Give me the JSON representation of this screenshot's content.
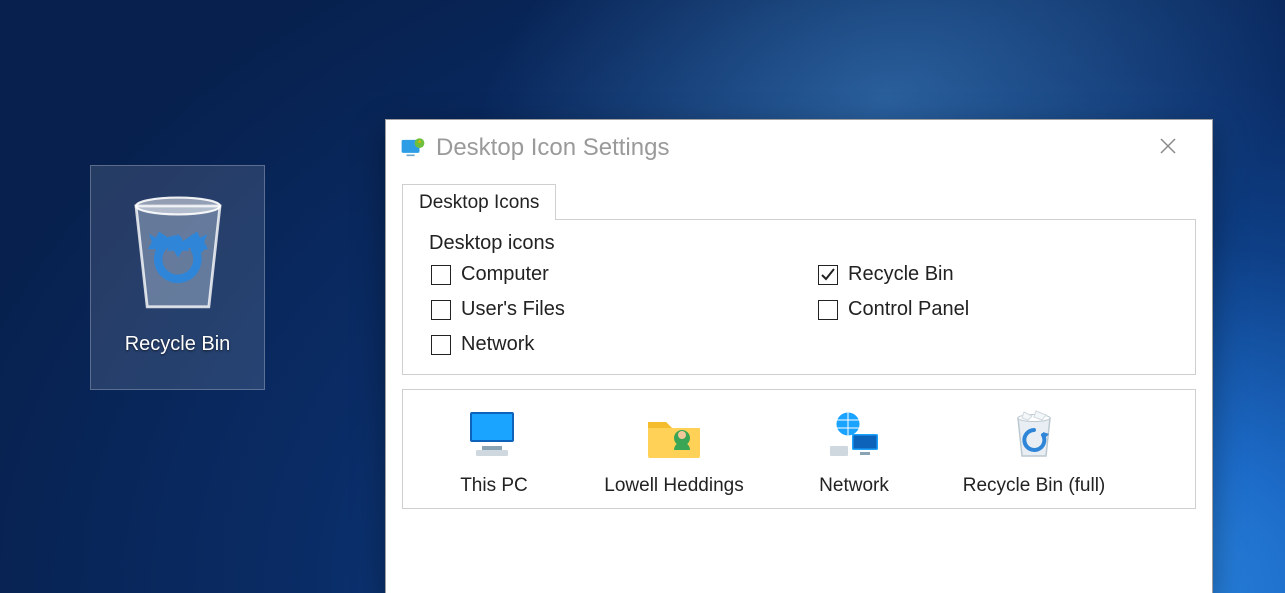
{
  "desktop": {
    "recycle_bin_label": "Recycle Bin"
  },
  "dialog": {
    "title": "Desktop Icon Settings",
    "tab_label": "Desktop Icons",
    "group_title": "Desktop icons",
    "checkboxes": {
      "computer": {
        "label": "Computer",
        "checked": false
      },
      "recycle_bin": {
        "label": "Recycle Bin",
        "checked": true
      },
      "users_files": {
        "label": "User's Files",
        "checked": false
      },
      "control_panel": {
        "label": "Control Panel",
        "checked": false
      },
      "network": {
        "label": "Network",
        "checked": false
      }
    },
    "preview_items": {
      "this_pc": {
        "label": "This PC"
      },
      "user": {
        "label": "Lowell Heddings"
      },
      "network": {
        "label": "Network"
      },
      "recycle_bin_full": {
        "label": "Recycle Bin (full)"
      }
    }
  }
}
